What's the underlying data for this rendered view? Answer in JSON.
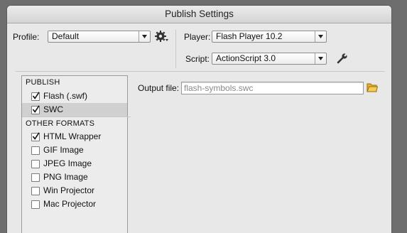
{
  "window": {
    "title": "Publish Settings"
  },
  "profile": {
    "label": "Profile:",
    "value": "Default",
    "options_icon": "gear-icon"
  },
  "player": {
    "label": "Player:",
    "value": "Flash Player 10.2"
  },
  "script": {
    "label": "Script:",
    "value": "ActionScript 3.0",
    "settings_icon": "wrench-icon"
  },
  "formats": {
    "publish_header": "PUBLISH",
    "publish_items": [
      {
        "label": "Flash (.swf)",
        "checked": true
      },
      {
        "label": "SWC",
        "checked": true,
        "selected": true
      }
    ],
    "other_header": "OTHER FORMATS",
    "other_items": [
      {
        "label": "HTML Wrapper",
        "checked": true
      },
      {
        "label": "GIF Image",
        "checked": false
      },
      {
        "label": "JPEG Image",
        "checked": false
      },
      {
        "label": "PNG Image",
        "checked": false
      },
      {
        "label": "Win Projector",
        "checked": false
      },
      {
        "label": "Mac Projector",
        "checked": false
      }
    ]
  },
  "output": {
    "label": "Output file:",
    "value": "flash-symbols.swc",
    "browse_icon": "folder-icon"
  },
  "colors": {
    "window_bg": "#e8e8e8",
    "selected_row": "#d0d0d0",
    "folder": "#e8b22a"
  }
}
